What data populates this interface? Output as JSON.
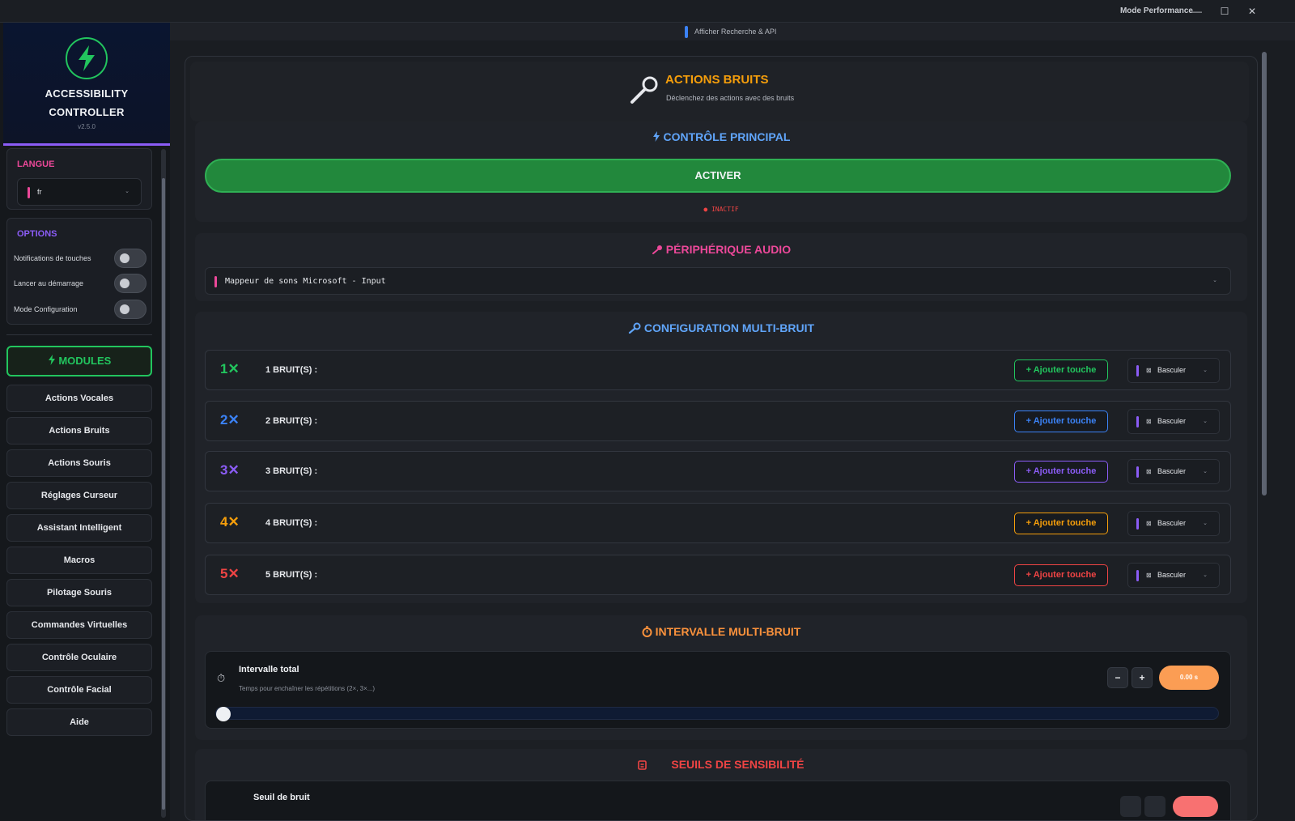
{
  "window": {
    "mode_label": "Mode Performance",
    "minimize": "—",
    "maximize": "☐",
    "close": "✕"
  },
  "topbar": {
    "toggle_label": "Afficher Recherche & API"
  },
  "brand": {
    "line1": "ACCESSIBILITY",
    "line2": "CONTROLLER",
    "version": "v2.5.0"
  },
  "language": {
    "heading": "LANGUE",
    "value": "fr",
    "chevron": "⌄"
  },
  "options": {
    "heading": "OPTIONS",
    "items": [
      {
        "label": "Notifications de touches",
        "on": false
      },
      {
        "label": "Lancer au démarrage",
        "on": false
      },
      {
        "label": "Mode Configuration",
        "on": false
      }
    ]
  },
  "modules": {
    "heading": "MODULES",
    "items": [
      "Actions Vocales",
      "Actions Bruits",
      "Actions Souris",
      "Réglages Curseur",
      "Assistant Intelligent",
      "Macros",
      "Pilotage Souris",
      "Commandes Virtuelles",
      "Contrôle Oculaire",
      "Contrôle Facial",
      "Aide"
    ]
  },
  "page": {
    "title": "ACTIONS BRUITS",
    "subtitle": "Déclenchez des actions avec des bruits"
  },
  "main_control": {
    "title": "CONTRÔLE PRINCIPAL",
    "button": "ACTIVER",
    "status": "● INACTIF"
  },
  "audio": {
    "title": "PÉRIPHÉRIQUE AUDIO",
    "device": "Mappeur de sons Microsoft - Input",
    "chevron": "⌄"
  },
  "multi": {
    "title": "CONFIGURATION MULTI-BRUIT",
    "rows": [
      {
        "count": "1✕",
        "label": "1 BRUIT(S) :",
        "add": "+ Ajouter touche",
        "mode": "Basculer",
        "color": "#22c55e"
      },
      {
        "count": "2✕",
        "label": "2 BRUIT(S) :",
        "add": "+ Ajouter touche",
        "mode": "Basculer",
        "color": "#3b82f6"
      },
      {
        "count": "3✕",
        "label": "3 BRUIT(S) :",
        "add": "+ Ajouter touche",
        "mode": "Basculer",
        "color": "#8b5cf6"
      },
      {
        "count": "4✕",
        "label": "4 BRUIT(S) :",
        "add": "+ Ajouter touche",
        "mode": "Basculer",
        "color": "#f59e0b"
      },
      {
        "count": "5✕",
        "label": "5 BRUIT(S) :",
        "add": "+ Ajouter touche",
        "mode": "Basculer",
        "color": "#ef4444"
      }
    ]
  },
  "interval": {
    "title": "INTERVALLE MULTI-BRUIT",
    "label": "Intervalle total",
    "hint": "Temps pour enchaîner les répétitions (2×, 3×...)",
    "minus": "−",
    "plus": "+",
    "value": "0.00 s",
    "level": 0
  },
  "thresholds": {
    "title": "SEUILS DE SENSIBILITÉ",
    "first_label": "Seuil de bruit"
  },
  "colors": {
    "green": "#22c55e",
    "orange": "#f59e0b",
    "pink": "#ec4899",
    "blue": "#60a5fa",
    "purple": "#8b5cf6",
    "red": "#ef4444"
  }
}
